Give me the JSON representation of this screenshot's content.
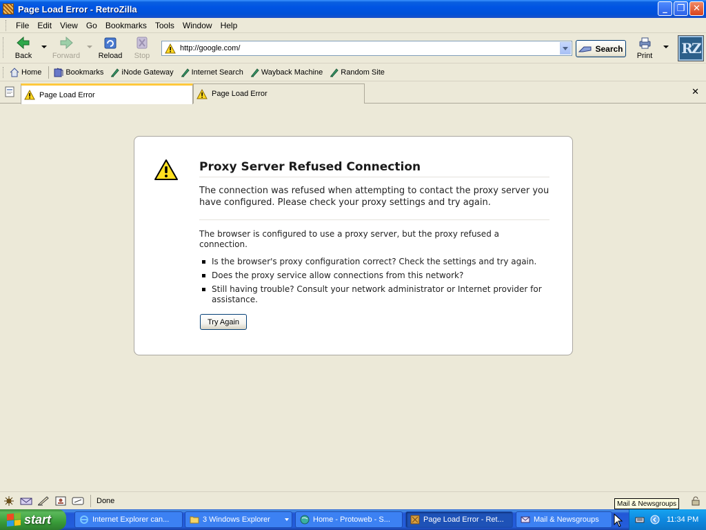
{
  "window": {
    "title": "Page Load Error - RetroZilla",
    "minimize": "_",
    "maximize": "❐",
    "close": "✕"
  },
  "menubar": {
    "items": [
      {
        "label": "File"
      },
      {
        "label": "Edit"
      },
      {
        "label": "View"
      },
      {
        "label": "Go"
      },
      {
        "label": "Bookmarks"
      },
      {
        "label": "Tools"
      },
      {
        "label": "Window"
      },
      {
        "label": "Help"
      }
    ]
  },
  "navbar": {
    "back": "Back",
    "forward": "Forward",
    "reload": "Reload",
    "stop": "Stop",
    "url": "http://google.com/",
    "search": "Search",
    "print": "Print",
    "logo": "RZ"
  },
  "personalbar": {
    "items": [
      {
        "label": "Home",
        "icon": "home-icon"
      },
      {
        "label": "Bookmarks",
        "icon": "bookmarks-icon"
      },
      {
        "label": "iNode Gateway",
        "icon": "bookmark-link-icon"
      },
      {
        "label": "Internet Search",
        "icon": "bookmark-link-icon"
      },
      {
        "label": "Wayback Machine",
        "icon": "bookmark-link-icon"
      },
      {
        "label": "Random Site",
        "icon": "bookmark-link-icon"
      }
    ]
  },
  "tabs": [
    {
      "label": "Page Load Error",
      "active": true
    },
    {
      "label": "Page Load Error",
      "active": false
    }
  ],
  "error": {
    "title": "Proxy Server Refused Connection",
    "short_desc": "The connection was refused when attempting to contact the proxy server you have configured. Please check your proxy settings and try again.",
    "long_intro": "The browser is configured to use a proxy server, but the proxy refused a connection.",
    "bullets": [
      "Is the browser's proxy configuration correct? Check the settings and try again.",
      "Does the proxy service allow connections from this network?",
      "Still having trouble? Consult your network administrator or Internet provider for assistance."
    ],
    "try_again": "Try Again"
  },
  "statusbar": {
    "text": "Done"
  },
  "tooltip": "Mail & Newsgroups",
  "taskbar": {
    "start": "start",
    "tasks": [
      {
        "label": "Internet Explorer can..."
      },
      {
        "label": "3 Windows Explorer"
      },
      {
        "label": "Home - Protoweb - S..."
      },
      {
        "label": "Page Load Error - Ret..."
      },
      {
        "label": "Mail & Newsgroups"
      }
    ],
    "clock": "11:34 PM"
  },
  "colors": {
    "titlebar": "#0054e3",
    "taskbar": "#245edb",
    "start": "#3a9d3a",
    "active_tab_accent": "#ffc83c",
    "chrome_bg": "#ece9d8"
  }
}
